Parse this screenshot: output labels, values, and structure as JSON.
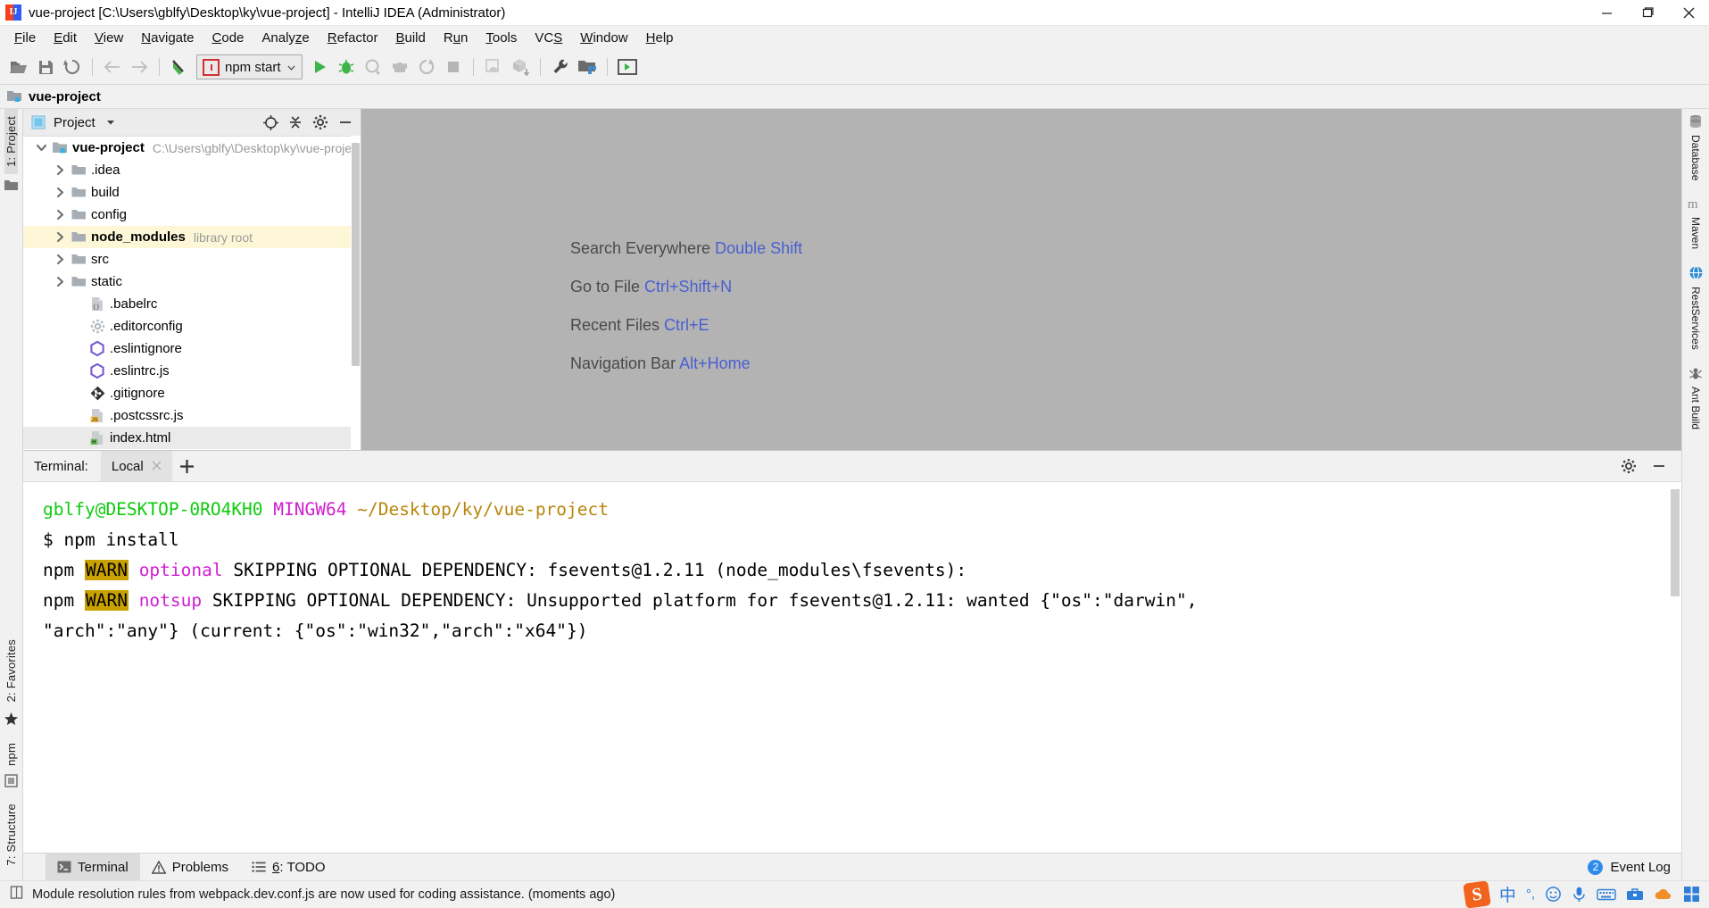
{
  "window": {
    "title": "vue-project [C:\\Users\\gblfy\\Desktop\\ky\\vue-project] - IntelliJ IDEA (Administrator)",
    "app_icon": "intellij-idea-icon",
    "minimize": "minimize-icon",
    "maximize": "maximize-icon",
    "close": "close-icon"
  },
  "menu": [
    {
      "label": "File",
      "mnemonic": "F"
    },
    {
      "label": "Edit",
      "mnemonic": "E"
    },
    {
      "label": "View",
      "mnemonic": "V"
    },
    {
      "label": "Navigate",
      "mnemonic": "N"
    },
    {
      "label": "Code",
      "mnemonic": "C"
    },
    {
      "label": "Analyze",
      "mnemonic": "z"
    },
    {
      "label": "Refactor",
      "mnemonic": "R"
    },
    {
      "label": "Build",
      "mnemonic": "B"
    },
    {
      "label": "Run",
      "mnemonic": "u"
    },
    {
      "label": "Tools",
      "mnemonic": "T"
    },
    {
      "label": "VCS",
      "mnemonic": "S"
    },
    {
      "label": "Window",
      "mnemonic": "W"
    },
    {
      "label": "Help",
      "mnemonic": "H"
    }
  ],
  "toolbar": {
    "open_label": "open-folder-icon",
    "save_label": "save-all-icon",
    "sync_label": "sync-icon",
    "back_label": "back-arrow-icon",
    "forward_label": "forward-arrow-icon",
    "last_edit_label": "last-edit-location-icon",
    "run_config": "npm start",
    "run_label": "run-icon",
    "debug_label": "debug-icon",
    "coverage_label": "run-with-coverage-icon",
    "profile_label": "profiler-icon",
    "rerun_label": "attach-icon",
    "stop_label": "stop-icon",
    "avd_label": "avd-manager-icon",
    "sdk_label": "sdk-manager-icon",
    "settings_label": "wrench-settings-icon",
    "project_structure_label": "project-structure-icon",
    "terminal_label": "open-terminal-icon"
  },
  "navbar": {
    "project": "vue-project"
  },
  "left_stripe": [
    {
      "label": "1: Project",
      "selected": true
    }
  ],
  "left_stripe_bottom": [
    {
      "label": "2: Favorites"
    },
    {
      "label": "npm"
    },
    {
      "label": "7: Structure"
    }
  ],
  "right_stripe": [
    {
      "label": "Database",
      "icon": "database-icon"
    },
    {
      "label": "Maven",
      "icon": "maven-icon"
    },
    {
      "label": "RestServices",
      "icon": "rest-services-icon"
    },
    {
      "label": "Ant Build",
      "icon": "ant-build-icon"
    }
  ],
  "project_panel": {
    "title": "Project",
    "view_icon": "project-view-icon",
    "dropdown_icon": "chevron-down-icon",
    "locate_icon": "scroll-from-source-icon",
    "collapse_icon": "collapse-all-icon",
    "settings_icon": "gear-icon",
    "hide_icon": "hide-icon",
    "tree": [
      {
        "label": "vue-project",
        "sub": "C:\\Users\\gblfy\\Desktop\\ky\\vue-project",
        "icon": "project-root-icon",
        "expanded": true,
        "depth": 0,
        "bold": true
      },
      {
        "label": ".idea",
        "sub": "",
        "icon": "folder-icon",
        "expanded": false,
        "depth": 1,
        "bold": false
      },
      {
        "label": "build",
        "sub": "",
        "icon": "folder-icon",
        "expanded": false,
        "depth": 1,
        "bold": false
      },
      {
        "label": "config",
        "sub": "",
        "icon": "folder-icon",
        "expanded": false,
        "depth": 1,
        "bold": false
      },
      {
        "label": "node_modules",
        "sub": "library root",
        "icon": "folder-icon",
        "expanded": false,
        "depth": 1,
        "bold": true,
        "highlight": true
      },
      {
        "label": "src",
        "sub": "",
        "icon": "folder-icon",
        "expanded": false,
        "depth": 1,
        "bold": false
      },
      {
        "label": "static",
        "sub": "",
        "icon": "folder-icon",
        "expanded": false,
        "depth": 1,
        "bold": false
      },
      {
        "label": ".babelrc",
        "sub": "",
        "icon": "babel-file-icon",
        "depth": 2,
        "bold": false
      },
      {
        "label": ".editorconfig",
        "sub": "",
        "icon": "editorconfig-gear-icon",
        "depth": 2,
        "bold": false
      },
      {
        "label": ".eslintignore",
        "sub": "",
        "icon": "eslint-icon",
        "depth": 2,
        "bold": false
      },
      {
        "label": ".eslintrc.js",
        "sub": "",
        "icon": "eslint-icon",
        "depth": 2,
        "bold": false
      },
      {
        "label": ".gitignore",
        "sub": "",
        "icon": "git-icon",
        "depth": 2,
        "bold": false
      },
      {
        "label": ".postcssrc.js",
        "sub": "",
        "icon": "js-file-icon",
        "depth": 2,
        "bold": false
      },
      {
        "label": "index.html",
        "sub": "",
        "icon": "html-file-icon",
        "depth": 2,
        "bold": false,
        "selected": true
      }
    ]
  },
  "editor": {
    "hints": [
      {
        "action": "Search Everywhere",
        "shortcut": "Double Shift"
      },
      {
        "action": "Go to File",
        "shortcut": "Ctrl+Shift+N"
      },
      {
        "action": "Recent Files",
        "shortcut": "Ctrl+E"
      },
      {
        "action": "Navigation Bar",
        "shortcut": "Alt+Home"
      }
    ]
  },
  "terminal": {
    "label": "Terminal:",
    "tab": "Local",
    "close_icon": "close-icon",
    "add_icon": "plus-icon",
    "settings_icon": "gear-icon",
    "hide_icon": "hide-icon",
    "lines": [
      {
        "segments": [
          {
            "text": "gblfy@DESKTOP-0RO4KH0",
            "color": "green"
          },
          {
            "text": " ",
            "color": "black"
          },
          {
            "text": "MINGW64",
            "color": "magenta"
          },
          {
            "text": " ",
            "color": "black"
          },
          {
            "text": "~/Desktop/ky/vue-project",
            "color": "olive"
          }
        ]
      },
      {
        "segments": [
          {
            "text": "$ npm install",
            "color": "black"
          }
        ]
      },
      {
        "segments": [
          {
            "text": "npm ",
            "color": "black"
          },
          {
            "text": "WARN",
            "color": "warn"
          },
          {
            "text": " ",
            "color": "black"
          },
          {
            "text": "optional",
            "color": "magenta"
          },
          {
            "text": " SKIPPING OPTIONAL DEPENDENCY: fsevents@1.2.11 (node_modules\\fsevents):",
            "color": "black"
          }
        ]
      },
      {
        "segments": [
          {
            "text": "npm ",
            "color": "black"
          },
          {
            "text": "WARN",
            "color": "warn"
          },
          {
            "text": " ",
            "color": "black"
          },
          {
            "text": "notsup",
            "color": "magenta"
          },
          {
            "text": " SKIPPING OPTIONAL DEPENDENCY: Unsupported platform for fsevents@1.2.11: wanted {\"os\":\"darwin\",",
            "color": "black"
          }
        ]
      },
      {
        "segments": [
          {
            "text": "\"arch\":\"any\"} (current: {\"os\":\"win32\",\"arch\":\"x64\"})",
            "color": "black"
          }
        ]
      }
    ]
  },
  "bottom_tabs": [
    {
      "label": "Terminal",
      "icon": "terminal-icon",
      "selected": true,
      "prefix": ""
    },
    {
      "label": "Problems",
      "icon": "warning-triangle-icon",
      "selected": false,
      "prefix": ""
    },
    {
      "label": ": TODO",
      "icon": "todo-list-icon",
      "selected": false,
      "prefix": "6"
    }
  ],
  "event_log": {
    "count": "2",
    "label": "Event Log"
  },
  "status_bar": {
    "icon": "document-icon",
    "message": "Module resolution rules from webpack.dev.conf.js are now used for coding assistance. (moments ago)"
  },
  "tray": [
    {
      "name": "sogou-input-icon",
      "glyph": "S"
    },
    {
      "name": "chinese-mode-icon",
      "glyph": "中"
    },
    {
      "name": "punctuation-icon",
      "glyph": "°,"
    },
    {
      "name": "emoji-icon",
      "glyph": "☺"
    },
    {
      "name": "microphone-icon",
      "glyph": "🎤"
    },
    {
      "name": "keyboard-icon",
      "glyph": "⌨"
    },
    {
      "name": "toolbox-icon",
      "glyph": "🧰"
    },
    {
      "name": "cloud-icon",
      "glyph": "☁"
    },
    {
      "name": "apps-icon",
      "glyph": "▦"
    }
  ],
  "colors": {
    "accent_blue": "#2d8ceb",
    "terminal_green": "#0ecb0e",
    "terminal_magenta": "#d020d0",
    "terminal_olive": "#b8860b",
    "warn_bg": "#c9a200",
    "editor_bg": "#b3b3b3",
    "highlight_row": "#fdf7d8"
  }
}
